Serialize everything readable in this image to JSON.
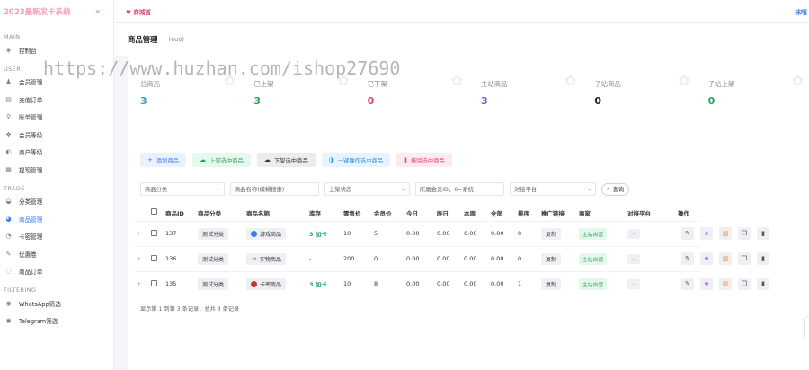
{
  "brand": {
    "title": "2023最新发卡系统",
    "collapse_icon": "double-chevron-left-icon"
  },
  "topbar": {
    "store_link": "♥ 商城首",
    "corner": "抹嘻"
  },
  "sidebar": {
    "sections": [
      {
        "title": "MAIN",
        "items": [
          {
            "label": "控制台",
            "icon": "dashboard-icon",
            "glyph": "◈"
          }
        ]
      },
      {
        "title": "USER",
        "items": [
          {
            "label": "会员管理",
            "icon": "user-icon",
            "glyph": "♟"
          },
          {
            "label": "充值订单",
            "icon": "recharge-icon",
            "glyph": "▤"
          },
          {
            "label": "账单管理",
            "icon": "bill-icon",
            "glyph": "♀"
          },
          {
            "label": "会员等级",
            "icon": "level-icon",
            "glyph": "❖"
          },
          {
            "label": "商户等级",
            "icon": "merchant-level-icon",
            "glyph": "◐"
          },
          {
            "label": "提现管理",
            "icon": "withdraw-icon",
            "glyph": "▦"
          }
        ]
      },
      {
        "title": "TRADE",
        "items": [
          {
            "label": "分类管理",
            "icon": "category-icon",
            "glyph": "◒"
          },
          {
            "label": "商品管理",
            "icon": "goods-icon",
            "glyph": "◕",
            "active": true
          },
          {
            "label": "卡密管理",
            "icon": "card-key-icon",
            "glyph": "◔"
          },
          {
            "label": "优惠卷",
            "icon": "coupon-icon",
            "glyph": "✎"
          },
          {
            "label": "商品订单",
            "icon": "order-icon",
            "glyph": "◌"
          }
        ]
      },
      {
        "title": "FILTERING",
        "items": [
          {
            "label": "WhatsApp筛选",
            "icon": "whatsapp-icon",
            "glyph": "◉"
          },
          {
            "label": "Telegram筛选",
            "icon": "telegram-icon",
            "glyph": "◉"
          }
        ]
      }
    ]
  },
  "page": {
    "title": "商品管理",
    "subtitle": "(ouo)"
  },
  "watermark": "https://www.huzhan.com/ishop27690",
  "stats": [
    {
      "label": "总商品",
      "value": "3",
      "color": "#2f9ed8"
    },
    {
      "label": "已上架",
      "value": "3",
      "color": "#22a55b"
    },
    {
      "label": "已下架",
      "value": "0",
      "color": "#e0445a"
    },
    {
      "label": "主站商品",
      "value": "3",
      "color": "#7b4dc6"
    },
    {
      "label": "子站商品",
      "value": "0",
      "color": "#222222"
    },
    {
      "label": "子站上架",
      "value": "0",
      "color": "#22a55b"
    }
  ],
  "toolbar": {
    "add": "添加商品",
    "shelf_on": "上架选中商品",
    "shelf_off": "下架选中商品",
    "batch": "一键操作选中商品",
    "delete": "移除选中商品"
  },
  "filters": {
    "category": "商品分类",
    "name_placeholder": "商品名称(模糊搜索)",
    "status": "上架状态",
    "member_placeholder": "所属会员ID，0=系统",
    "platform": "对接平台",
    "search": "查询"
  },
  "table": {
    "headers": [
      "商品ID",
      "商品分类",
      "商品名称",
      "库存",
      "零售价",
      "会员价",
      "今日",
      "昨日",
      "本周",
      "全部",
      "排序",
      "推广链接",
      "商家",
      "对接平台",
      "操作"
    ],
    "rows": [
      {
        "id": "137",
        "category": "测试分类",
        "name": "游戏商品",
        "type_icon": "game-icon",
        "type_glyph": "●",
        "type_color": "#3a7df0",
        "stock": "3 加卡",
        "stock_green": true,
        "retail": "10",
        "member": "5",
        "today": "0.00",
        "yesterday": "0.00",
        "week": "0.00",
        "all": "0.00",
        "sort": "0",
        "promo": "复制",
        "merchant": "主站自营",
        "platform": "-"
      },
      {
        "id": "136",
        "category": "测试分类",
        "name": "实物商品",
        "type_icon": "physical-icon",
        "type_glyph": "→",
        "type_color": "#8a8f99",
        "stock": "-",
        "stock_green": false,
        "retail": "200",
        "member": "0",
        "today": "0.00",
        "yesterday": "0.00",
        "week": "0.00",
        "all": "0.00",
        "sort": "0",
        "promo": "复制",
        "merchant": "主站自营",
        "platform": "-"
      },
      {
        "id": "135",
        "category": "测试分类",
        "name": "卡密商品",
        "type_icon": "card-icon",
        "type_glyph": "●",
        "type_color": "#c0392b",
        "stock": "3 加卡",
        "stock_green": true,
        "retail": "10",
        "member": "8",
        "today": "0.00",
        "yesterday": "0.00",
        "week": "0.00",
        "all": "0.00",
        "sort": "1",
        "promo": "复制",
        "merchant": "主站自营",
        "platform": "-"
      }
    ],
    "ops": [
      {
        "icon": "edit-icon",
        "glyph": "✎",
        "tone": ""
      },
      {
        "icon": "star-icon",
        "glyph": "★",
        "tone": "pur"
      },
      {
        "icon": "card-list-icon",
        "glyph": "▥",
        "tone": "ora"
      },
      {
        "icon": "copy-icon",
        "glyph": "❐",
        "tone": ""
      },
      {
        "icon": "trash-icon",
        "glyph": "▮",
        "tone": ""
      }
    ]
  },
  "pagination": "显示第 1 到第 3 条记录，总共 3 条记录"
}
